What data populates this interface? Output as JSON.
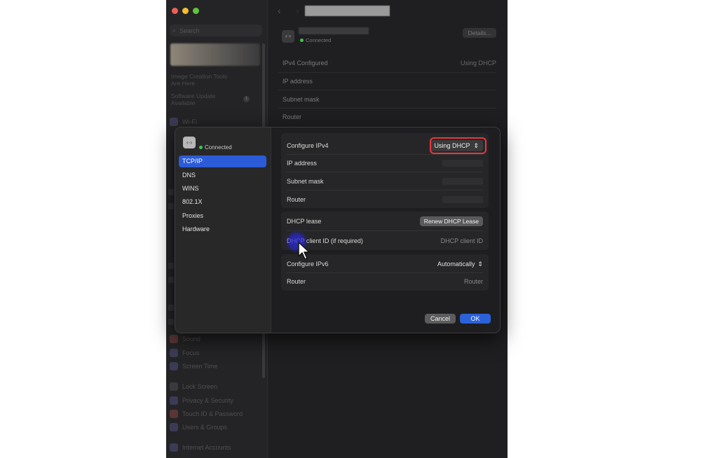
{
  "sidebar": {
    "search_placeholder": "Search",
    "notes": [
      "Image Creation Tools",
      "Are Here",
      "Software Update",
      "Available"
    ],
    "badge": "1",
    "items": [
      {
        "label": "Wi-Fi",
        "icon": "wifi-icon"
      },
      {
        "label": "Sound",
        "icon": "sound-icon"
      },
      {
        "label": "Focus",
        "icon": "focus-icon"
      },
      {
        "label": "Screen Time",
        "icon": "screen-time-icon"
      },
      {
        "label": "Lock Screen",
        "icon": "lock-icon"
      },
      {
        "label": "Privacy & Security",
        "icon": "privacy-icon"
      },
      {
        "label": "Touch ID & Password",
        "icon": "fingerprint-icon"
      },
      {
        "label": "Users & Groups",
        "icon": "users-icon"
      },
      {
        "label": "Internet Accounts",
        "icon": "internet-accounts-icon"
      }
    ]
  },
  "main": {
    "status": "Connected",
    "details_label": "Details...",
    "rows": [
      {
        "label": "IPv4 Configured",
        "value": "Using DHCP"
      },
      {
        "label": "IP address",
        "value": ""
      },
      {
        "label": "Subnet mask",
        "value": ""
      },
      {
        "label": "Router",
        "value": ""
      }
    ]
  },
  "sheet": {
    "status": "Connected",
    "nav": [
      "TCP/IP",
      "DNS",
      "WINS",
      "802.1X",
      "Proxies",
      "Hardware"
    ],
    "active_nav": "TCP/IP",
    "ipv4": {
      "configure_label": "Configure IPv4",
      "configure_value": "Using DHCP",
      "ip_label": "IP address",
      "subnet_label": "Subnet mask",
      "router_label": "Router"
    },
    "dhcp": {
      "lease_label": "DHCP lease",
      "renew_label": "Renew DHCP Lease",
      "client_id_label": "DHCP client ID (if required)",
      "client_id_placeholder": "DHCP client ID"
    },
    "ipv6": {
      "configure_label": "Configure IPv6",
      "configure_value": "Automatically",
      "router_label": "Router",
      "router_placeholder": "Router"
    },
    "cancel_label": "Cancel",
    "ok_label": "OK"
  },
  "colors": {
    "accent": "#2b5bd7",
    "highlight": "#e8383d",
    "connected": "#39c750"
  }
}
